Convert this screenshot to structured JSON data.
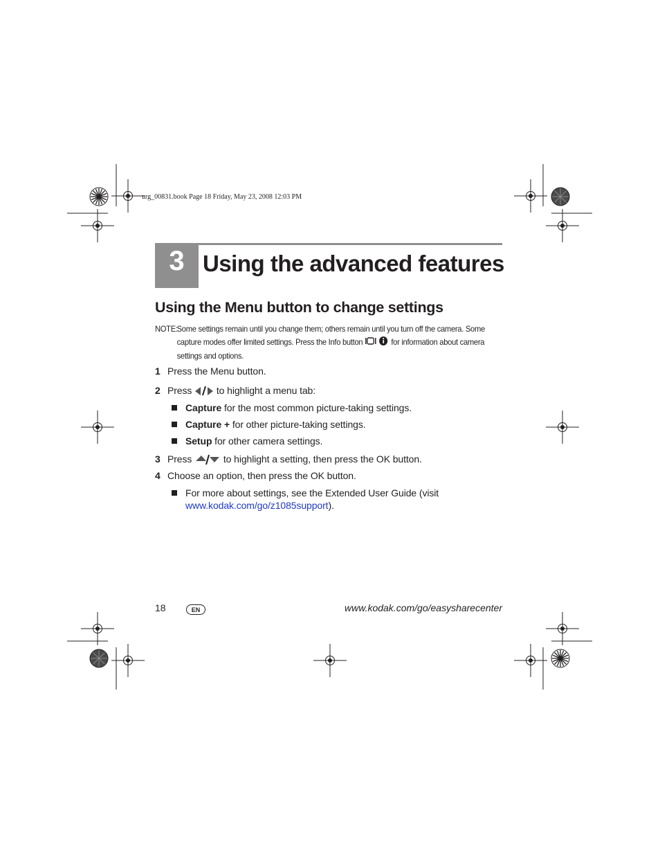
{
  "header": {
    "book_line": "urg_00831.book  Page 18  Friday, May 23, 2008  12:03 PM"
  },
  "chapter": {
    "number": "3",
    "title": "Using the advanced features"
  },
  "section": {
    "title": "Using the Menu button to change settings"
  },
  "note": {
    "label": "NOTE:",
    "text_before_icon": "Some settings remain until you change them; others remain until you turn off the camera. Some capture modes offer limited settings. Press the Info button",
    "text_after_icon": "for information about camera settings and options.",
    "icon": "info-button-icon"
  },
  "steps": [
    {
      "num": "1",
      "text": "Press the Menu button."
    },
    {
      "num": "2",
      "pre": "Press",
      "icon": "left-right-arrows-icon",
      "post": "to highlight a menu tab:"
    },
    {
      "num": "3",
      "pre": "Press",
      "icon": "up-down-arrows-icon",
      "post": "to highlight a setting, then press the OK button."
    },
    {
      "num": "4",
      "text": "Choose an option, then press the OK button."
    }
  ],
  "tab_bullets": [
    {
      "bold": "Capture",
      "text": " for the most common picture-taking settings."
    },
    {
      "bold": "Capture +",
      "text": " for other picture-taking settings."
    },
    {
      "bold": "Setup",
      "text": " for other camera settings."
    }
  ],
  "more_bullet": {
    "text": "For more about settings, see the Extended User Guide (visit",
    "link": "www.kodak.com/go/z1085support",
    "after": ")."
  },
  "footer": {
    "page_number": "18",
    "language_badge": "EN",
    "url": "www.kodak.com/go/easysharecenter"
  },
  "colors": {
    "chapter_gray": "#8f8f8f",
    "text": "#231f20",
    "link": "#1f3bc7"
  }
}
